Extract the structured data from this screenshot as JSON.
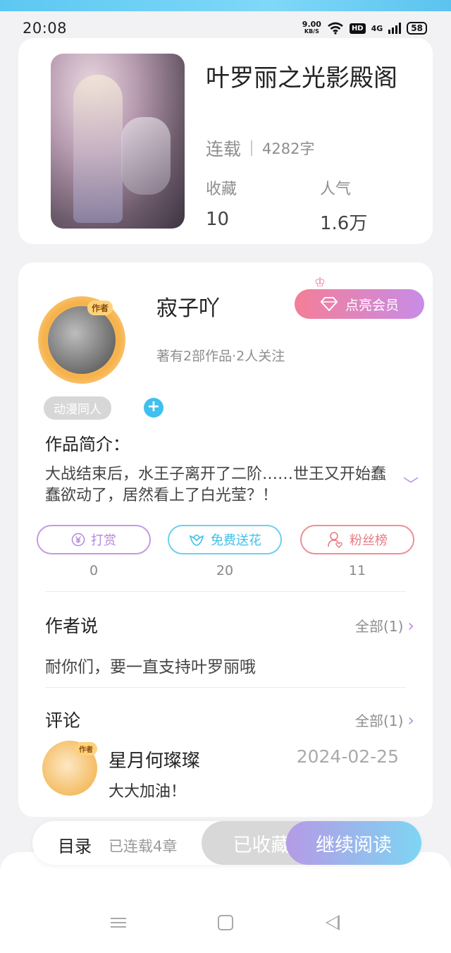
{
  "status_bar": {
    "time": "20:08",
    "net_speed": "9.00",
    "net_speed_unit": "KB/S",
    "hd_label": "HD",
    "network_label": "4G",
    "battery": "58"
  },
  "book": {
    "title": "叶罗丽之光影殿阁",
    "status": "连载",
    "word_count": "4282字",
    "favorites_label": "收藏",
    "favorites_value": "10",
    "popularity_label": "人气",
    "popularity_value": "1.6万"
  },
  "author": {
    "badge": "作者",
    "name": "寂子吖",
    "info": "著有2部作品·2人关注",
    "vip_button": "点亮会员",
    "tag": "动漫同人",
    "tag_add": "+"
  },
  "intro": {
    "heading": "作品简介：",
    "text": " 大战结束后，水王子离开了二阶……世王又开始蠢蠢欲动了，居然看上了白光莹？！"
  },
  "actions": [
    {
      "label": "打赏",
      "count": "0",
      "icon": "yen-icon"
    },
    {
      "label": "免费送花",
      "count": "20",
      "icon": "flower-icon"
    },
    {
      "label": "粉丝榜",
      "count": "11",
      "icon": "fan-icon"
    }
  ],
  "author_says": {
    "heading": "作者说",
    "all_label": "全部(1)",
    "text": "耐你们，要一直支持叶罗丽哦"
  },
  "comments": {
    "heading": "评论",
    "all_label": "全部(1)",
    "items": [
      {
        "badge": "作者",
        "name": "星月何璨璨",
        "date": "2024-02-25",
        "text": "大大加油！"
      }
    ]
  },
  "bottom_bar": {
    "toc_label": "目录",
    "toc_sub": "已连载4章",
    "favorited_label": "已收藏",
    "continue_label": "继续阅读"
  },
  "colors": {
    "accent_purple": "#b791df",
    "accent_blue": "#3fc0f0",
    "accent_pink": "#f47e97"
  }
}
